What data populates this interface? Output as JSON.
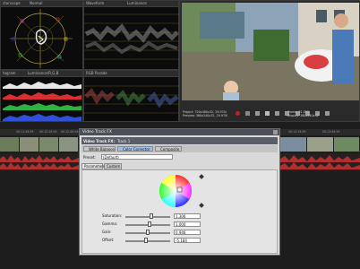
{
  "scopes": {
    "vectorscope_label": "ctorscope",
    "vectorscope_mode": "Normal",
    "waveform_label": "Waveform",
    "waveform_mode": "Luminance",
    "histogram_label": "togram",
    "histogram_mode": "Luminance/R,G,B",
    "parade_label": "RGB Parade"
  },
  "preview": {
    "project_label": "Project:",
    "project_value": "720x480x32, 29.970i",
    "preview_label": "Preview:",
    "preview_value": "360x240x32, 29.970i",
    "frame_label": "Frame:",
    "frame_value": "21,053",
    "display_label": "Display:",
    "display_value": "360x240x32"
  },
  "timeline": {
    "timecodes_left": [
      "00:11:49:29",
      "00:12:19:29",
      "00:12:49:29"
    ],
    "timecodes_right": [
      "00:13:19:29",
      "00:13:49:29"
    ]
  },
  "dialog": {
    "title": "Video Track FX",
    "track_label": "Video Track FX:",
    "track_name": "Track 1",
    "tabs": [
      "White Balance",
      "Color Corrector",
      "Composite"
    ],
    "preset_label": "Preset:",
    "preset_value": "(Default)",
    "subtabs": [
      "Parameters",
      "Custom"
    ],
    "params": [
      {
        "name": "Saturation:",
        "value": "1.306",
        "fill": 0.55
      },
      {
        "name": "Gamma:",
        "value": "1.000",
        "fill": 0.5
      },
      {
        "name": "Gain:",
        "value": "0.946",
        "fill": 0.47
      },
      {
        "name": "Offset:",
        "value": "-5.184",
        "fill": 0.44
      }
    ]
  },
  "colors": {
    "accent": "#3a78c8",
    "waveform_audio": "#b03030"
  }
}
